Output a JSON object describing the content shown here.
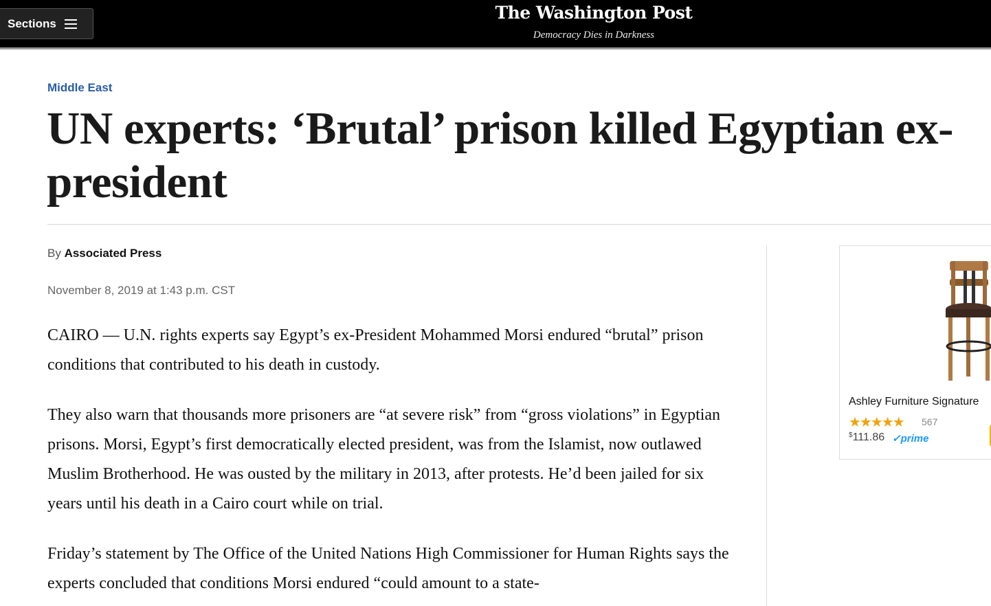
{
  "header": {
    "sections_label": "Sections",
    "logo": "The Washington Post",
    "tagline": "Democracy Dies in Darkness"
  },
  "article": {
    "kicker": "Middle East",
    "headline": "UN experts: ‘Brutal’ prison killed Egyptian ex-president",
    "byline_prefix": "By",
    "author": "Associated Press",
    "date": "November 8, 2019 at 1:43 p.m. CST",
    "paragraphs": [
      "CAIRO — U.N. rights experts say Egypt’s ex-President Mohammed Morsi endured “brutal” prison conditions that contributed to his death in custody.",
      "They also warn that thousands more prisoners are “at severe risk” from “gross violations” in Egyptian prisons. Morsi, Egypt’s first democratically elected president, was from the Islamist, now outlawed Muslim Brotherhood. He was ousted by the military in 2013, after protests. He’d been jailed for six years until his death in a Cairo court while on trial.",
      "Friday’s statement by The Office of the United Nations High Commissioner for Human Rights says the experts concluded that conditions Morsi endured “could amount to a state-"
    ]
  },
  "ad": {
    "title": "Ashley Furniture Signature",
    "rating_stars": 4.5,
    "rating_count": "567",
    "price_currency": "$",
    "price": "111.86",
    "prime_label": "✓prime"
  }
}
